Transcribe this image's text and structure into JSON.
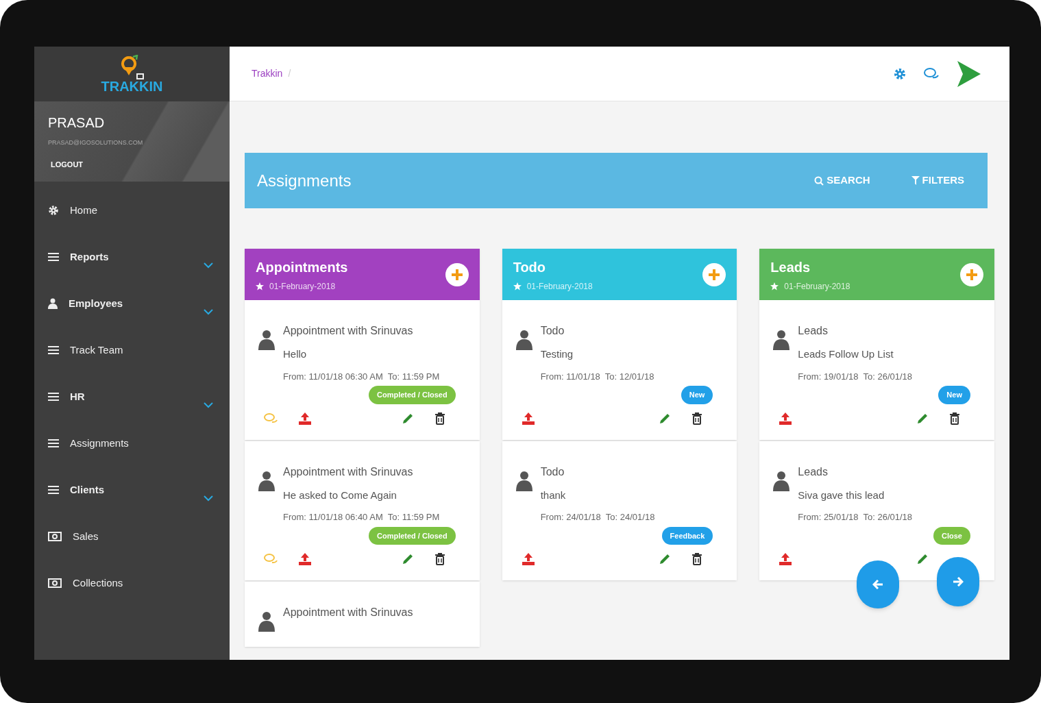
{
  "brand": {
    "name": "TRAKKIN"
  },
  "user": {
    "name": "PRASAD",
    "email": "PRASAD@IGOSOLUTIONS.COM",
    "logout": "LOGOUT"
  },
  "sidebar": {
    "items": [
      {
        "label": "Home",
        "kind": "gear",
        "expandable": false
      },
      {
        "label": "Reports",
        "kind": "list",
        "expandable": true
      },
      {
        "label": "Employees",
        "kind": "person",
        "expandable": true
      },
      {
        "label": "Track Team",
        "kind": "list",
        "expandable": false
      },
      {
        "label": "HR",
        "kind": "list",
        "expandable": true
      },
      {
        "label": "Assignments",
        "kind": "list",
        "expandable": false
      },
      {
        "label": "Clients",
        "kind": "list",
        "expandable": true
      },
      {
        "label": "Sales",
        "kind": "money",
        "expandable": false
      },
      {
        "label": "Collections",
        "kind": "money",
        "expandable": false
      }
    ]
  },
  "breadcrumb": [
    "Trakkin",
    "/"
  ],
  "page": {
    "title": "Assignments",
    "search": "SEARCH",
    "filters": "FILTERS"
  },
  "columns": [
    {
      "title": "Appointments",
      "date": "01-February-2018",
      "color": "#a241c0",
      "cards": [
        {
          "title": "Appointment with Srinuvas",
          "description": "Hello",
          "time": "From: 11/01/18 06:30 AM  To: 11:59 PM",
          "status": "Completed / Closed",
          "color": "#7cc242",
          "comments": true,
          "deletable": true
        },
        {
          "title": "Appointment with Srinuvas",
          "description": "He asked to Come Again",
          "time": "From: 11/01/18 06:40 AM  To: 11:59 PM",
          "status": "Completed / Closed",
          "color": "#7cc242",
          "comments": true,
          "deletable": true
        },
        {
          "title": "Appointment with Srinuvas"
        }
      ]
    },
    {
      "title": "Todo",
      "date": "01-February-2018",
      "color": "#2fc3dc",
      "cards": [
        {
          "title": "Todo",
          "description": "Testing",
          "time": "From: 11/01/18  To: 12/01/18",
          "status": "New",
          "color": "#22a0e8",
          "comments": false,
          "deletable": true
        },
        {
          "title": "Todo",
          "description": "thank",
          "time": "From: 24/01/18  To: 24/01/18",
          "status": "Feedback",
          "color": "#22a0e8",
          "comments": false,
          "deletable": true
        }
      ]
    },
    {
      "title": "Leads",
      "date": "01-February-2018",
      "color": "#5cb85c",
      "cards": [
        {
          "title": "Leads",
          "description": "Leads Follow Up List",
          "time": "From: 19/01/18  To: 26/01/18",
          "status": "New",
          "color": "#22a0e8",
          "comments": false,
          "deletable": true
        },
        {
          "title": "Leads",
          "description": "Siva gave this lead",
          "time": "From: 25/01/18  To: 26/01/18",
          "status": "Close",
          "color": "#7cc242",
          "comments": false,
          "deletable": false
        }
      ]
    }
  ]
}
